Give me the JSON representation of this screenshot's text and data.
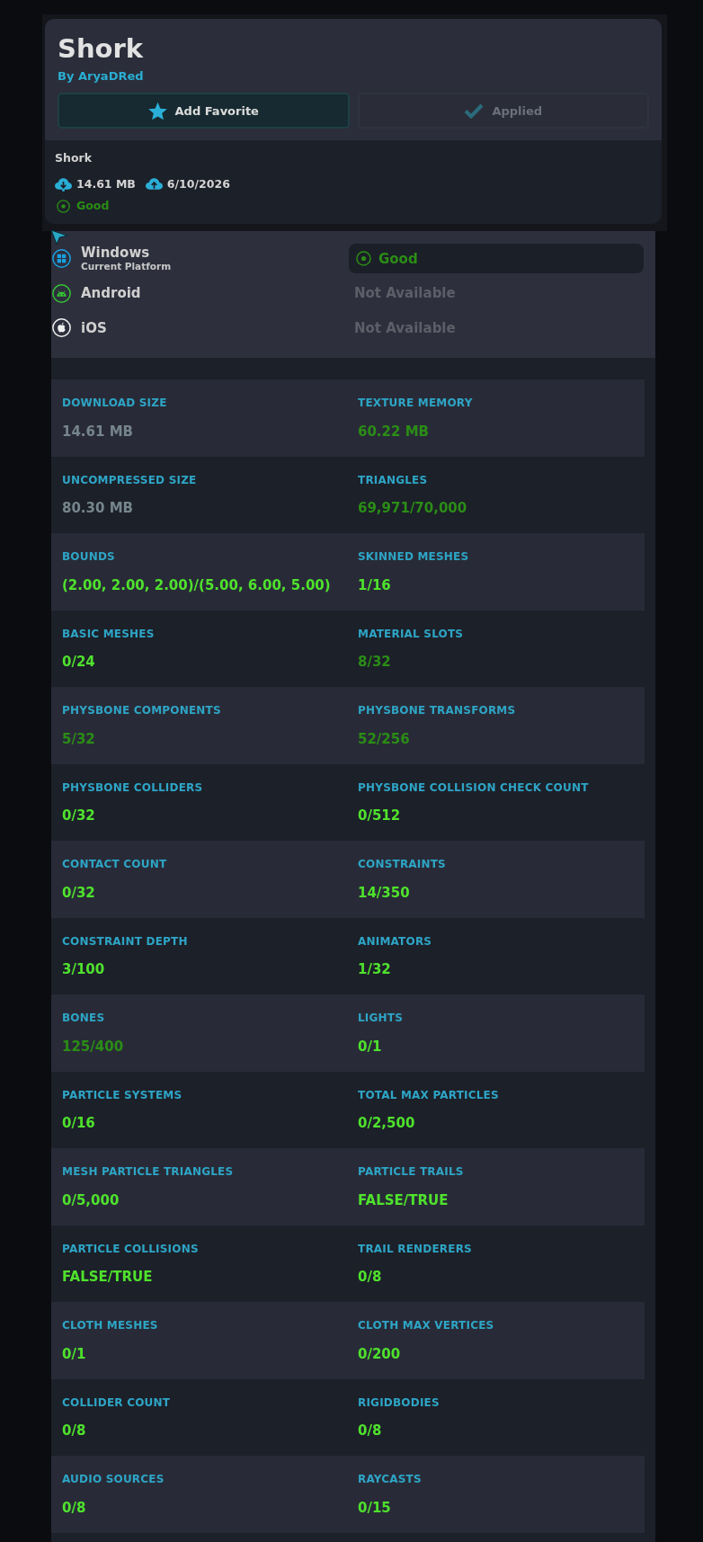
{
  "avatar": {
    "title": "Shork",
    "author": "By AryaDRed"
  },
  "buttons": [
    {
      "label": "Add Favorite",
      "kind": "favorite",
      "disabled": false
    },
    {
      "label": "Applied",
      "kind": "applied",
      "disabled": true
    }
  ],
  "details": {
    "name": "Shork",
    "download_size": "14.61 MB",
    "date": "6/10/2026",
    "rating": {
      "text": "Good",
      "color": "#2b8d16"
    }
  },
  "platforms": [
    {
      "name": "Windows",
      "kind": "windows",
      "subtitle": "Current Platform",
      "available": true,
      "status": "Good",
      "color": "#2b8d16"
    },
    {
      "name": "Android",
      "kind": "android",
      "available": false,
      "status": "Not Available"
    },
    {
      "name": "iOS",
      "kind": "ios",
      "available": false,
      "status": "Not Available"
    }
  ],
  "stats": [
    {
      "label": "DOWNLOAD SIZE",
      "value": "14.61 MB",
      "color": "#76858c"
    },
    {
      "label": "TEXTURE MEMORY",
      "value": "60.22 MB",
      "color": "#2b8d16"
    },
    {
      "label": "UNCOMPRESSED SIZE",
      "value": "80.30 MB",
      "color": "#76858c"
    },
    {
      "label": "TRIANGLES",
      "value": "69,971/70,000",
      "color": "#2b8d16"
    },
    {
      "label": "BOUNDS",
      "value": "(2.00, 2.00, 2.00)/(5.00, 6.00, 5.00)",
      "color": "#4fe22d"
    },
    {
      "label": "SKINNED MESHES",
      "value": "1/16",
      "color": "#4fe22d"
    },
    {
      "label": "BASIC MESHES",
      "value": "0/24",
      "color": "#4fe22d"
    },
    {
      "label": "MATERIAL SLOTS",
      "value": "8/32",
      "color": "#2b8d16"
    },
    {
      "label": "PHYSBONE COMPONENTS",
      "value": "5/32",
      "color": "#2b8d16"
    },
    {
      "label": "PHYSBONE TRANSFORMS",
      "value": "52/256",
      "color": "#2b8d16"
    },
    {
      "label": "PHYSBONE COLLIDERS",
      "value": "0/32",
      "color": "#4fe22d"
    },
    {
      "label": "PHYSBONE COLLISION CHECK COUNT",
      "value": "0/512",
      "color": "#4fe22d"
    },
    {
      "label": "CONTACT COUNT",
      "value": "0/32",
      "color": "#4fe22d"
    },
    {
      "label": "CONSTRAINTS",
      "value": "14/350",
      "color": "#4fe22d"
    },
    {
      "label": "CONSTRAINT DEPTH",
      "value": "3/100",
      "color": "#4fe22d"
    },
    {
      "label": "ANIMATORS",
      "value": "1/32",
      "color": "#4fe22d"
    },
    {
      "label": "BONES",
      "value": "125/400",
      "color": "#2b8d16"
    },
    {
      "label": "LIGHTS",
      "value": "0/1",
      "color": "#4fe22d"
    },
    {
      "label": "PARTICLE SYSTEMS",
      "value": "0/16",
      "color": "#4fe22d"
    },
    {
      "label": "TOTAL MAX PARTICLES",
      "value": "0/2,500",
      "color": "#4fe22d"
    },
    {
      "label": "MESH PARTICLE TRIANGLES",
      "value": "0/5,000",
      "color": "#4fe22d"
    },
    {
      "label": "PARTICLE TRAILS",
      "value": "FALSE/TRUE",
      "color": "#4fe22d"
    },
    {
      "label": "PARTICLE COLLISIONS",
      "value": "FALSE/TRUE",
      "color": "#4fe22d"
    },
    {
      "label": "TRAIL RENDERERS",
      "value": "0/8",
      "color": "#4fe22d"
    },
    {
      "label": "CLOTH MESHES",
      "value": "0/1",
      "color": "#4fe22d"
    },
    {
      "label": "CLOTH MAX VERTICES",
      "value": "0/200",
      "color": "#4fe22d"
    },
    {
      "label": "COLLIDER COUNT",
      "value": "0/8",
      "color": "#4fe22d"
    },
    {
      "label": "RIGIDBODIES",
      "value": "0/8",
      "color": "#4fe22d"
    },
    {
      "label": "AUDIO SOURCES",
      "value": "0/8",
      "color": "#4fe22d"
    },
    {
      "label": "RAYCASTS",
      "value": "0/15",
      "color": "#4fe22d"
    }
  ]
}
